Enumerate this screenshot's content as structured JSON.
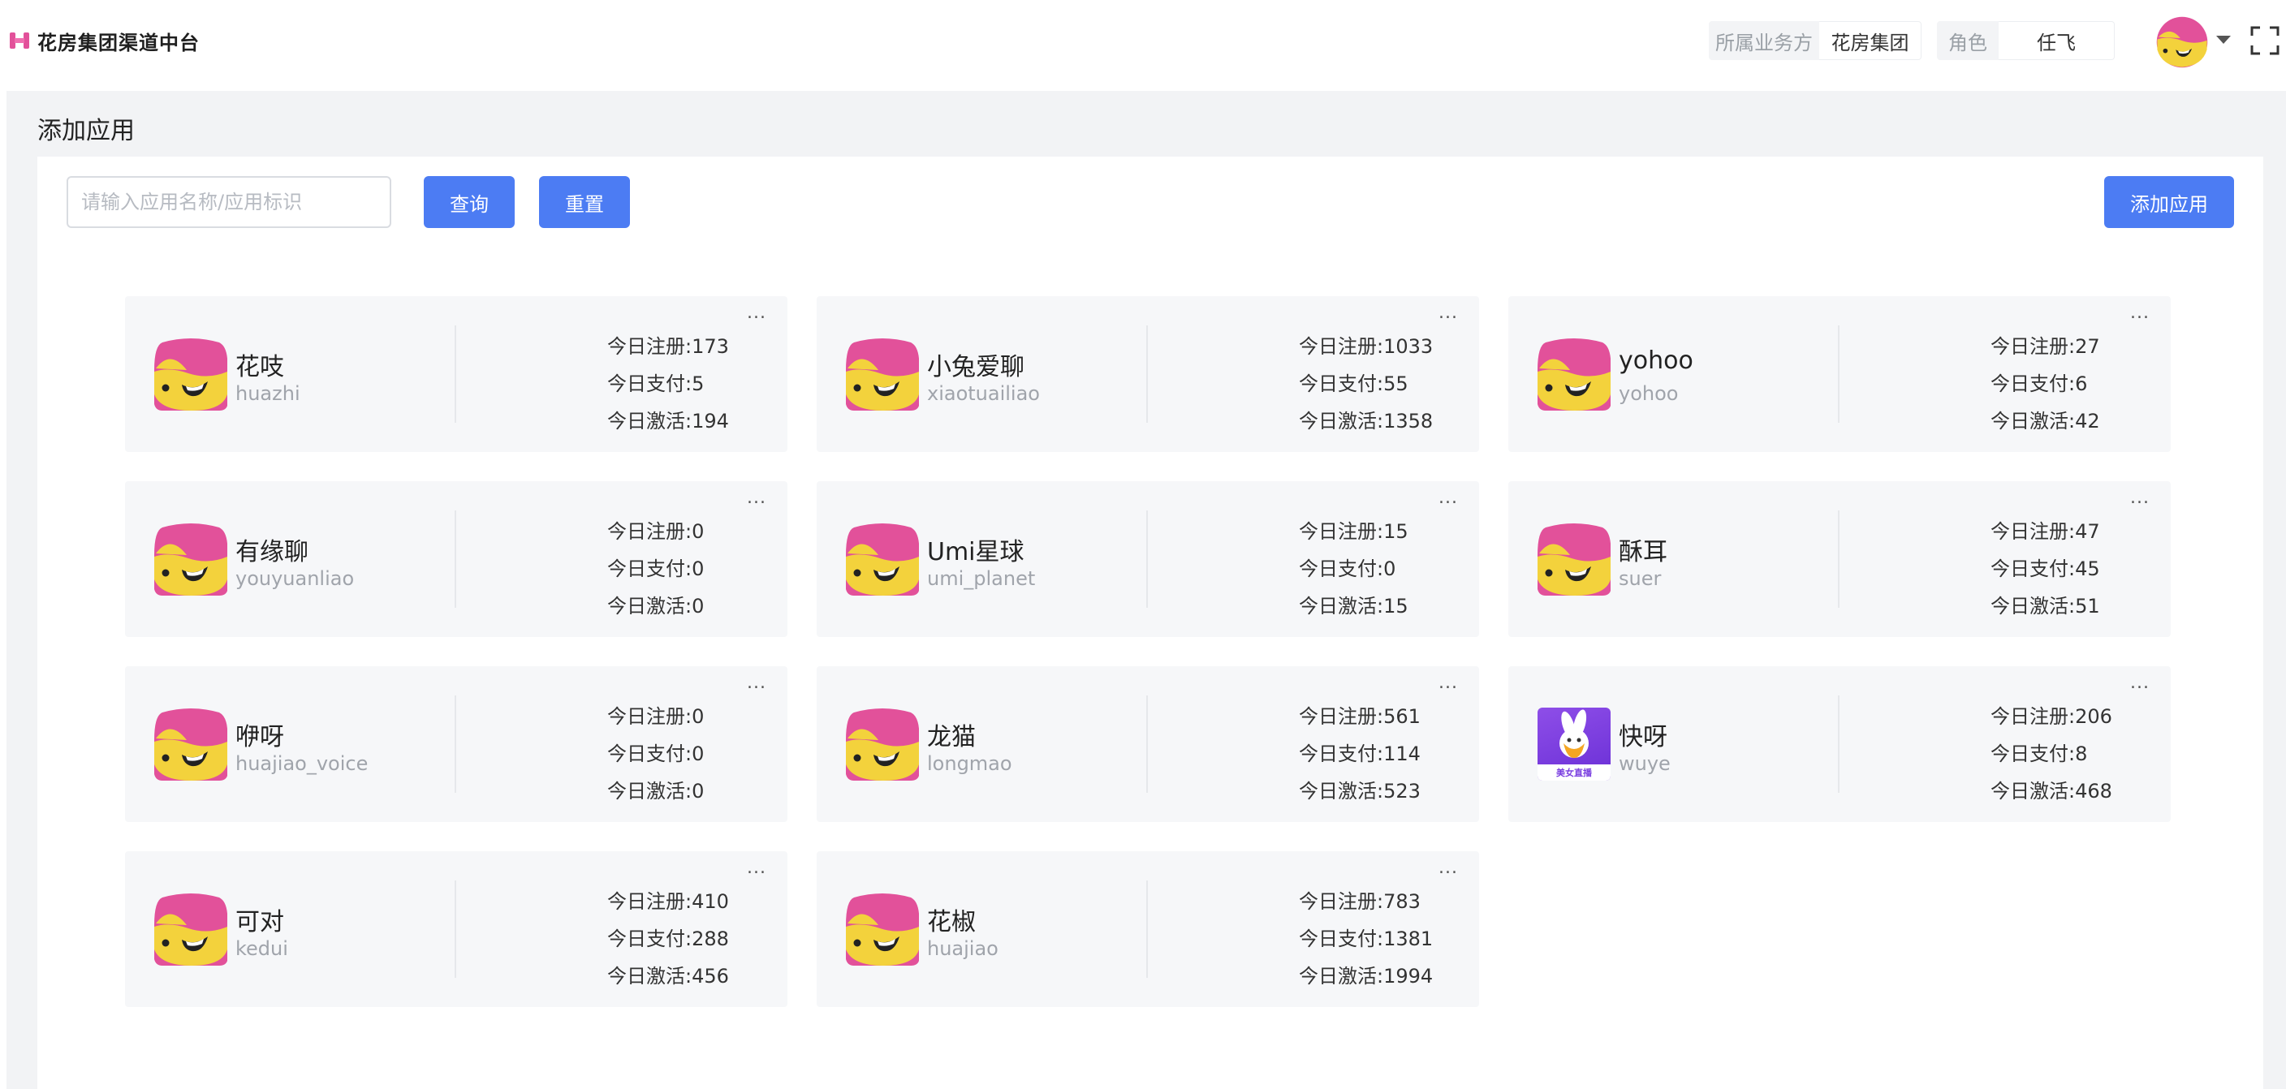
{
  "header": {
    "brand_name": "花房集团渠道中台",
    "biz_label": "所属业务方",
    "biz_value": "花房集团",
    "role_label": "角色",
    "role_value": "任飞"
  },
  "page": {
    "title": "添加应用",
    "search_placeholder": "请输入应用名称/应用标识",
    "query_label": "查询",
    "reset_label": "重置",
    "add_label": "添加应用",
    "more_label": "..."
  },
  "apps": [
    {
      "name": "花吱",
      "id": "huazhi",
      "register": "今日注册:173",
      "pay": "今日支付:5",
      "active": "今日激活:194",
      "icon": "mascot-icon"
    },
    {
      "name": "小兔爱聊",
      "id": "xiaotuailiao",
      "register": "今日注册:1033",
      "pay": "今日支付:55",
      "active": "今日激活:1358",
      "icon": "mascot-icon"
    },
    {
      "name": "yohoo",
      "id": "yohoo",
      "register": "今日注册:27",
      "pay": "今日支付:6",
      "active": "今日激活:42",
      "icon": "mascot-icon"
    },
    {
      "name": "有缘聊",
      "id": "youyuanliao",
      "register": "今日注册:0",
      "pay": "今日支付:0",
      "active": "今日激活:0",
      "icon": "mascot-icon"
    },
    {
      "name": "Umi星球",
      "id": "umi_planet",
      "register": "今日注册:15",
      "pay": "今日支付:0",
      "active": "今日激活:15",
      "icon": "mascot-icon"
    },
    {
      "name": "酥耳",
      "id": "suer",
      "register": "今日注册:47",
      "pay": "今日支付:45",
      "active": "今日激活:51",
      "icon": "mascot-icon"
    },
    {
      "name": "咿呀",
      "id": "huajiao_voice",
      "register": "今日注册:0",
      "pay": "今日支付:0",
      "active": "今日激活:0",
      "icon": "mascot-icon"
    },
    {
      "name": "龙猫",
      "id": "longmao",
      "register": "今日注册:561",
      "pay": "今日支付:114",
      "active": "今日激活:523",
      "icon": "mascot-icon"
    },
    {
      "name": "快呀",
      "id": "wuye",
      "register": "今日注册:206",
      "pay": "今日支付:8",
      "active": "今日激活:468",
      "icon": "rabbit-app-icon",
      "icon_caption": "美女直播"
    },
    {
      "name": "可对",
      "id": "kedui",
      "register": "今日注册:410",
      "pay": "今日支付:288",
      "active": "今日激活:456",
      "icon": "mascot-icon"
    },
    {
      "name": "花椒",
      "id": "huajiao",
      "register": "今日注册:783",
      "pay": "今日支付:1381",
      "active": "今日激活:1994",
      "icon": "mascot-icon"
    }
  ],
  "colors": {
    "primary": "#4c7cf3",
    "brand_pink": "#e2519a",
    "mascot_yellow": "#f3d23c",
    "card_bg": "#f6f7f9",
    "page_bg": "#f2f3f5"
  }
}
